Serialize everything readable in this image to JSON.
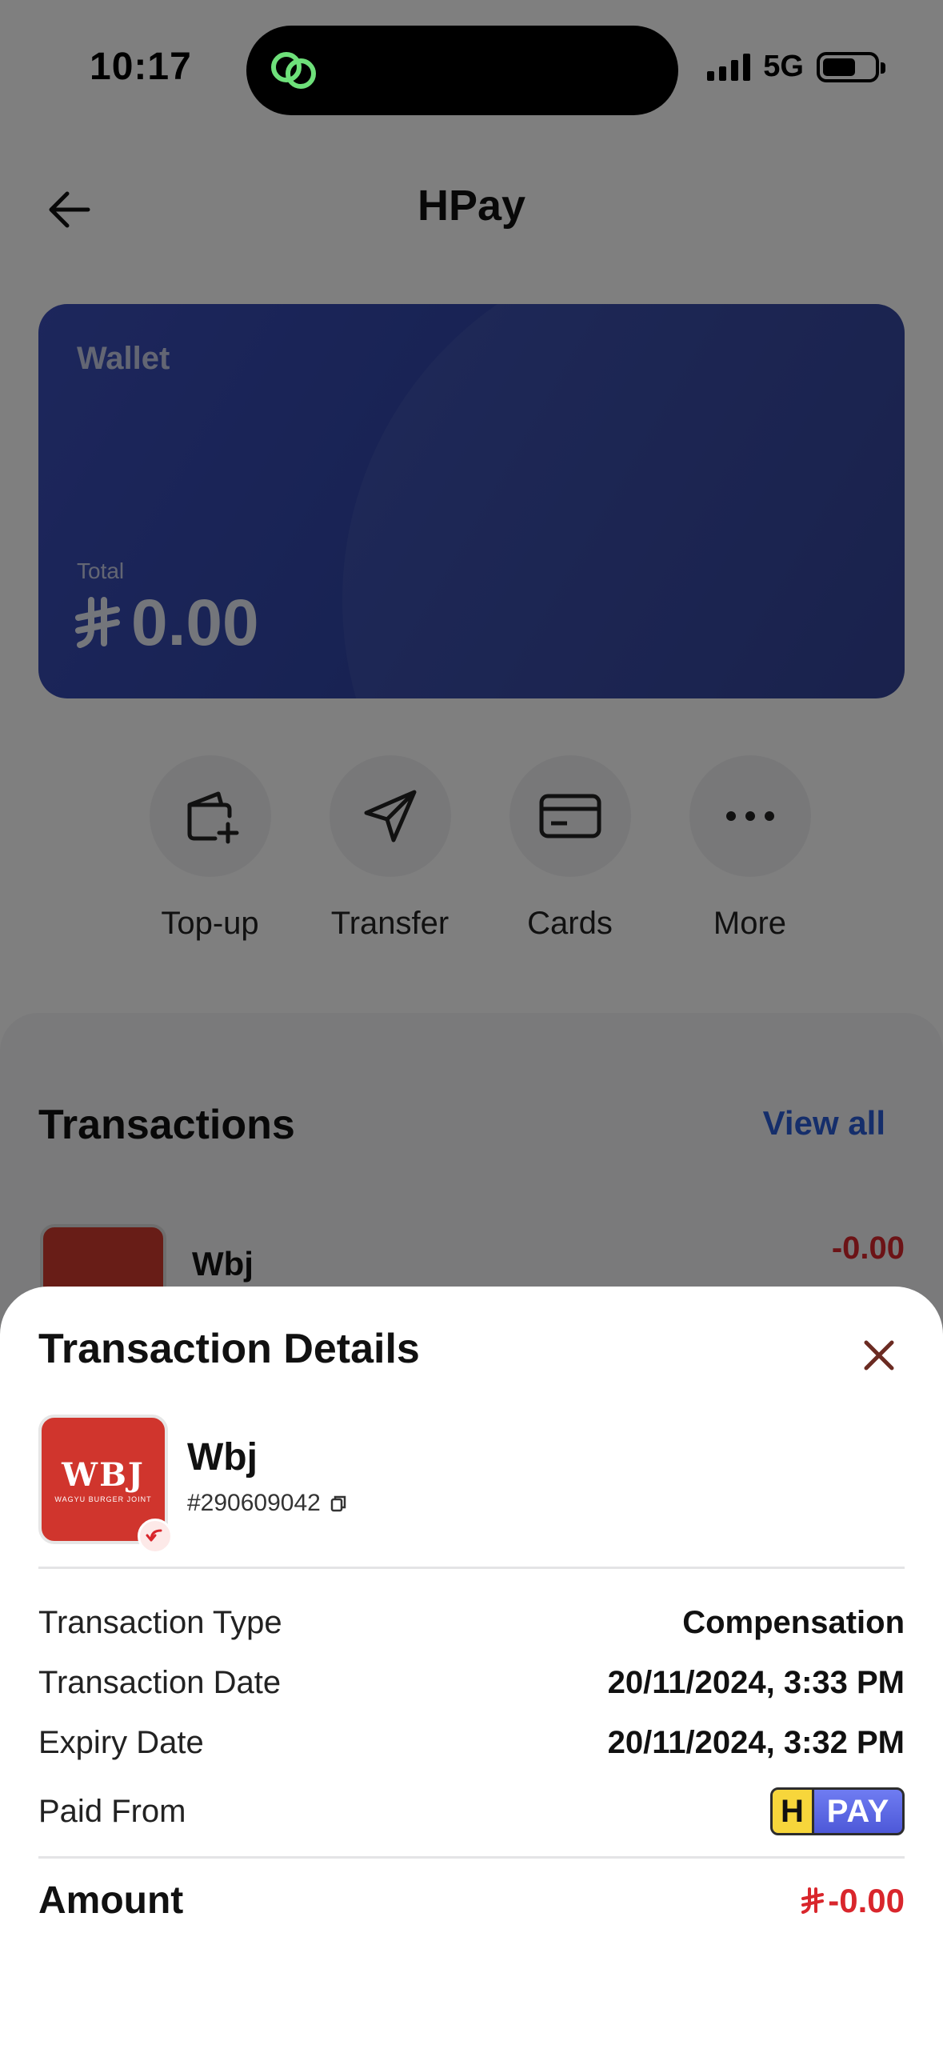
{
  "status_bar": {
    "time": "10:17",
    "network": "5G"
  },
  "header": {
    "title": "HPay"
  },
  "wallet": {
    "label": "Wallet",
    "total_label": "Total",
    "balance": "0.00"
  },
  "actions": [
    {
      "label": "Top-up",
      "icon": "wallet-add-icon"
    },
    {
      "label": "Transfer",
      "icon": "send-icon"
    },
    {
      "label": "Cards",
      "icon": "card-icon"
    },
    {
      "label": "More",
      "icon": "more-icon"
    }
  ],
  "transactions": {
    "title": "Transactions",
    "view_all": "View all",
    "items": [
      {
        "name": "Wbj",
        "amount": "-0.00"
      }
    ]
  },
  "details": {
    "title": "Transaction Details",
    "merchant_name": "Wbj",
    "merchant_logo_text": "WBJ",
    "merchant_logo_sub": "WAGYU BURGER JOINT",
    "transaction_id": "#290609042",
    "rows": [
      {
        "label": "Transaction Type",
        "value": "Compensation"
      },
      {
        "label": "Transaction Date",
        "value": "20/11/2024, 3:33 PM"
      },
      {
        "label": "Expiry Date",
        "value": "20/11/2024, 3:32 PM"
      }
    ],
    "paid_from_label": "Paid From",
    "paid_from_badge": {
      "h": "H",
      "text": "PAY"
    },
    "amount_label": "Amount",
    "amount_value": "-0.00"
  },
  "colors": {
    "accent": "#2b5cd6",
    "negative": "#d9262c",
    "wallet": "#3a4db8"
  }
}
